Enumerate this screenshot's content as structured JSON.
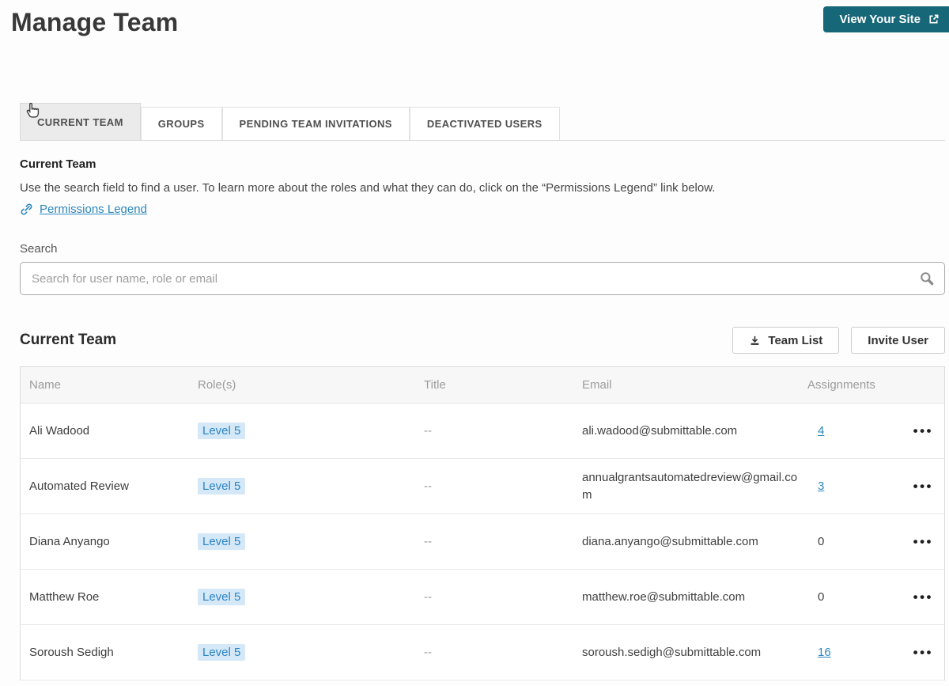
{
  "header": {
    "title": "Manage Team",
    "view_site_button": "View Your Site"
  },
  "tabs": [
    {
      "label": "CURRENT TEAM",
      "active": true
    },
    {
      "label": "GROUPS",
      "active": false
    },
    {
      "label": "PENDING TEAM INVITATIONS",
      "active": false
    },
    {
      "label": "DEACTIVATED USERS",
      "active": false
    }
  ],
  "intro": {
    "heading": "Current Team",
    "description": "Use the search field to find a user. To learn more about the roles and what they can do, click on the “Permissions Legend” link below.",
    "legend_link": "Permissions Legend"
  },
  "search": {
    "label": "Search",
    "placeholder": "Search for user name, role or email"
  },
  "team_section": {
    "heading": "Current Team",
    "team_list_button": "Team List",
    "invite_user_button": "Invite User"
  },
  "table": {
    "columns": {
      "name": "Name",
      "roles": "Role(s)",
      "title": "Title",
      "email": "Email",
      "assignments": "Assignments"
    },
    "row_menu_icon": "•••",
    "rows": [
      {
        "name": "Ali Wadood",
        "role": "Level 5",
        "title": "--",
        "email": "ali.wadood@submittable.com",
        "assignments": "4",
        "assignments_is_link": true
      },
      {
        "name": "Automated Review",
        "role": "Level 5",
        "title": "--",
        "email": "annualgrantsautomatedreview@gmail.com",
        "assignments": "3",
        "assignments_is_link": true
      },
      {
        "name": "Diana Anyango",
        "role": "Level 5",
        "title": "--",
        "email": "diana.anyango@submittable.com",
        "assignments": "0",
        "assignments_is_link": false
      },
      {
        "name": "Matthew Roe",
        "role": "Level 5",
        "title": "--",
        "email": "matthew.roe@submittable.com",
        "assignments": "0",
        "assignments_is_link": false
      },
      {
        "name": "Soroush Sedigh",
        "role": "Level 5",
        "title": "--",
        "email": "soroush.sedigh@submittable.com",
        "assignments": "16",
        "assignments_is_link": true
      }
    ]
  },
  "icons": {
    "view_site": "external-link",
    "legend": "link",
    "search": "magnifier",
    "team_list": "download",
    "row_menu": "three-dots",
    "tab_cursor": "hand-pointer"
  },
  "colors": {
    "accent_teal": "#166879",
    "link_blue": "#2b87be",
    "role_badge_bg": "#d4e8f7",
    "role_badge_text": "#2c84c4",
    "active_tab_bg": "#ebebeb",
    "table_header_bg": "#f7f7f7"
  }
}
